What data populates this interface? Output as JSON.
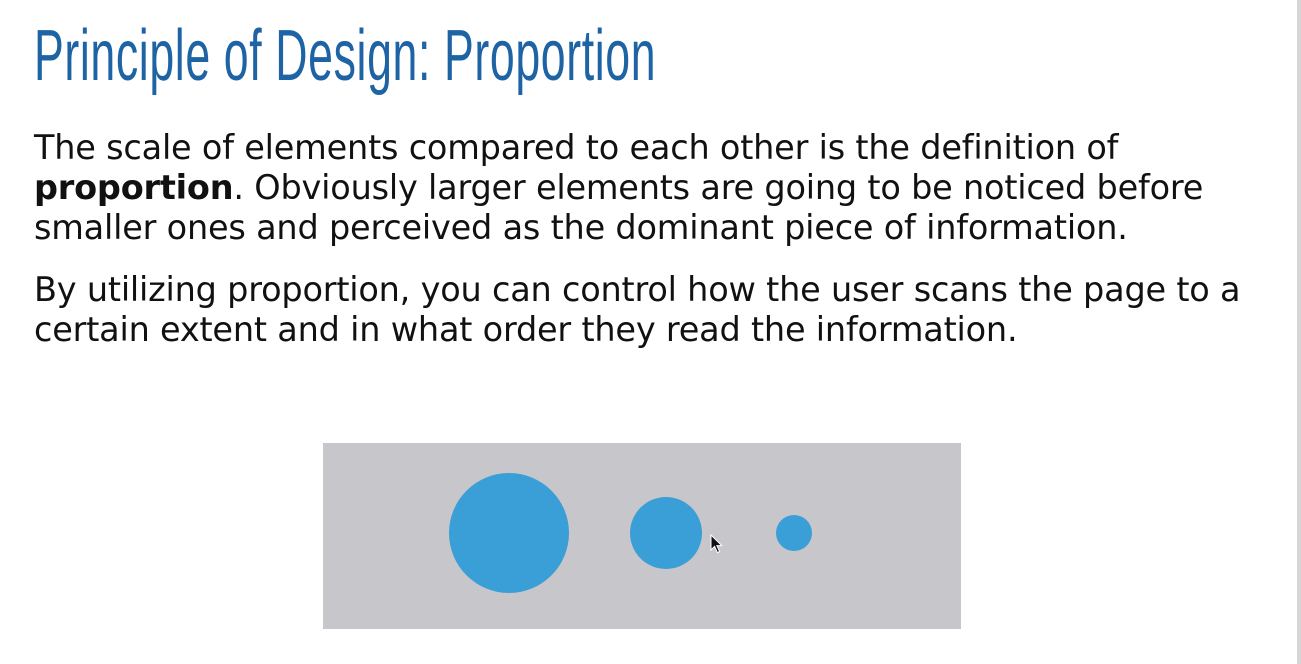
{
  "slide": {
    "title": "Principle of Design: Proportion",
    "paragraph1": {
      "before": "The scale of elements compared to each other is the definition of ",
      "bold": "proportion",
      "after": ". Obviously larger elements are going to be noticed before smaller ones and perceived as the dominant piece of information."
    },
    "paragraph2": "By utilizing proportion, you can control how the user scans the page to a certain extent and in what order they read the information."
  },
  "colors": {
    "title": "#1e63a3",
    "text": "#111111",
    "illustration_bg": "#c7c6ca",
    "circle": "#3a9fd6"
  },
  "illustration": {
    "shapes": [
      "large-circle",
      "medium-circle",
      "small-circle"
    ]
  },
  "icons": [
    "mouse-cursor-icon"
  ]
}
